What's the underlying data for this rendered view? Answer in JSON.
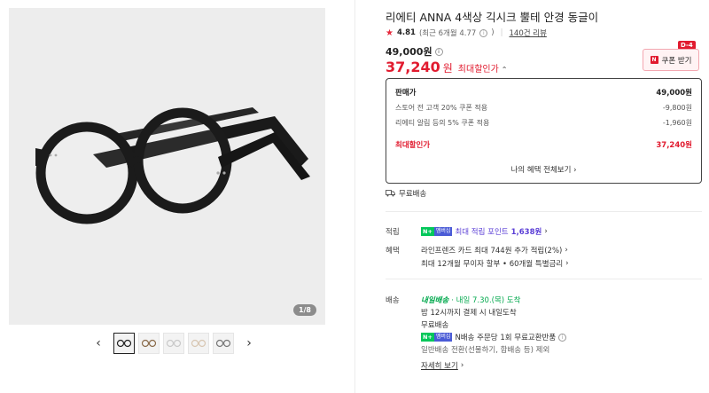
{
  "gallery": {
    "page_indicator": "1/8",
    "thumb_count": 5,
    "prev_icon": "chevron-left-icon",
    "next_icon": "chevron-right-icon"
  },
  "product": {
    "title": "리에티 ANNA 4색상 긱시크 뿔테 안경 동글이",
    "rating": "4.81",
    "rating_sub": "(최근 6개월 4.77",
    "rating_sub_close": ")",
    "review_count": "140건 리뷰"
  },
  "price": {
    "original": "49,000원",
    "sale": "37,240",
    "sale_unit": "원",
    "sale_label": "최대할인가",
    "caret": "⌃"
  },
  "coupon": {
    "dday": "D-4",
    "label": "쿠폰 받기"
  },
  "price_box": {
    "rows": [
      {
        "label": "판매가",
        "value": "49,000원"
      },
      {
        "label": "스토어 전 고객 20% 쿠폰 적용",
        "value": "-9,800원"
      },
      {
        "label": "리에티 알림 등의 5% 쿠폰 적용",
        "value": "-1,960원"
      }
    ],
    "max_label": "최대할인가",
    "max_value": "37,240원",
    "benefit_link": "나의 혜택 전체보기 ›"
  },
  "shipping_free": "무료배송",
  "points": {
    "label": "적립",
    "badge_n": "N+",
    "badge_m": "멤버십",
    "text": "최대 적립 포인트",
    "amount": "1,638원",
    "arrow": "›"
  },
  "benefits": {
    "label": "혜택",
    "line1": "라인프렌즈 카드 최대 744원 추가 적립(2%)",
    "line2": "최대 12개월 무이자 할부 • 60개월 특별금리",
    "arrow": "›"
  },
  "delivery": {
    "label": "배송",
    "badge": "내일배송",
    "eta": "· 내일 7.30.(목) 도착",
    "cutoff": "밤 12시까지 결제 시 내일도착",
    "free": "무료배송",
    "npay_text": "N배송 주문당 1회 무료교환반품",
    "exclude": "일반배송 전환(선물하기, 합배송 등) 제외",
    "detail_link": "자세히 보기",
    "arrow": "›"
  }
}
